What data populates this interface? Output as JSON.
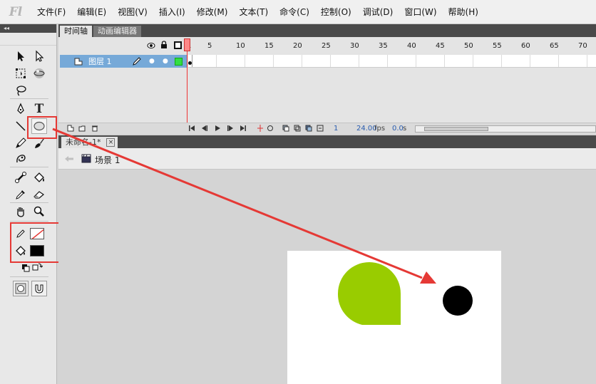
{
  "app": {
    "logo": "Fl",
    "menu": [
      "文件(F)",
      "编辑(E)",
      "视图(V)",
      "插入(I)",
      "修改(M)",
      "文本(T)",
      "命令(C)",
      "控制(O)",
      "调试(D)",
      "窗口(W)",
      "帮助(H)"
    ]
  },
  "tools": {
    "header": "◂◂",
    "items": [
      "selection-arrow",
      "subselect-arrow",
      "free-transform",
      "3d-rotation",
      "lasso",
      "pen",
      "text",
      "line",
      "oval",
      "pencil",
      "brush",
      "deco",
      "bone",
      "paint-bucket",
      "eyedropper",
      "eraser",
      "hand",
      "zoom",
      "stroke-color",
      "fill-color",
      "swap-colors",
      "object-drawing",
      "snap-to-objects"
    ],
    "text_tool_label": "T"
  },
  "timeline": {
    "tabs": [
      "时间轴",
      "动画编辑器"
    ],
    "active_tab": 0,
    "frame_numbers": [
      "1",
      "5",
      "10",
      "15",
      "20",
      "25",
      "30",
      "35",
      "40",
      "45",
      "50",
      "55",
      "60",
      "65",
      "70"
    ],
    "layers": [
      {
        "name": "图层 1"
      }
    ],
    "status": {
      "frame": "1",
      "fps": "24.00",
      "fps_unit": "fps",
      "time": "0.0",
      "time_unit": "s"
    }
  },
  "document": {
    "tab_title": "未命名-1*",
    "close_label": "×",
    "scene": "场景 1"
  },
  "colors": {
    "accent_red": "#e53935",
    "shape_green": "#99cc00",
    "shape_black": "#000000",
    "layer_selected": "#76a9d8"
  }
}
